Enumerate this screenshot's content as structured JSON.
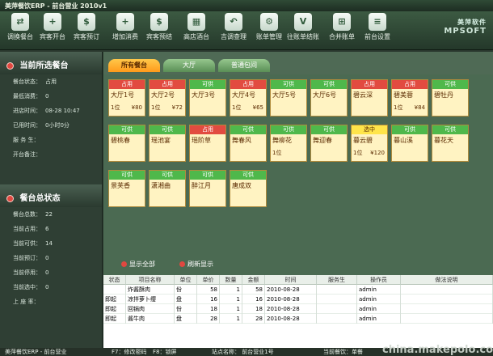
{
  "title": "美萍餐饮ERP - 前台营业 2010v1",
  "toolbar": [
    {
      "label": "调换餐台",
      "icon": "swap-icon"
    },
    {
      "label": "宾客开台",
      "icon": "open-table-icon"
    },
    {
      "label": "宾客预订",
      "icon": "reserve-icon"
    },
    {
      "label": "增加消费",
      "icon": "add-consume-icon"
    },
    {
      "label": "宾客预结",
      "icon": "prebill-icon"
    },
    {
      "label": "高店酒台",
      "icon": "hotel-table-icon"
    },
    {
      "label": "吉调查理",
      "icon": "undo-icon"
    },
    {
      "label": "账单管理",
      "icon": "gear-icon"
    },
    {
      "label": "往账单结账",
      "icon": "checkout-icon"
    },
    {
      "label": "合并账单",
      "icon": "merge-icon"
    },
    {
      "label": "前台设置",
      "icon": "settings-icon"
    }
  ],
  "brand": {
    "line1": "美萍软件",
    "line2": "MPSOFT"
  },
  "left": {
    "section1_title": "当前所选餐台",
    "items1": [
      {
        "k": "餐台状态：",
        "v": "占用"
      },
      {
        "k": "最低消费：",
        "v": "0"
      },
      {
        "k": "进店时间：",
        "v": "08-28 10:47"
      },
      {
        "k": "已用时间：",
        "v": "0小时0分"
      },
      {
        "k": "服 务 生：",
        "v": ""
      },
      {
        "k": "开台备注：",
        "v": ""
      }
    ],
    "section2_title": "餐台总状态",
    "items2": [
      {
        "k": "餐台总数：",
        "v": "22"
      },
      {
        "k": "当前占用：",
        "v": "6"
      },
      {
        "k": "当前可供：",
        "v": "14"
      },
      {
        "k": "当前预订：",
        "v": "0"
      },
      {
        "k": "当前停用：",
        "v": "0"
      },
      {
        "k": "当前选中：",
        "v": "0"
      },
      {
        "k": "上 座 率：",
        "v": ""
      }
    ]
  },
  "tabs": [
    "所有餐台",
    "大厅",
    "普通包间"
  ],
  "active_tab": 0,
  "tiles": [
    {
      "status": "占用",
      "color": "red",
      "name": "大厅1号",
      "people": "1位",
      "price": "¥80"
    },
    {
      "status": "占用",
      "color": "red",
      "name": "大厅2号",
      "people": "1位",
      "price": "¥72"
    },
    {
      "status": "可供",
      "color": "green",
      "name": "大厅3号",
      "people": "",
      "price": ""
    },
    {
      "status": "占用",
      "color": "red",
      "name": "大厅4号",
      "people": "1位",
      "price": "¥65"
    },
    {
      "status": "可供",
      "color": "green",
      "name": "大厅5号",
      "people": "",
      "price": ""
    },
    {
      "status": "可供",
      "color": "green",
      "name": "大厅6号",
      "people": "",
      "price": ""
    },
    {
      "status": "占用",
      "color": "red",
      "name": "碧云深",
      "people": "",
      "price": ""
    },
    {
      "status": "占用",
      "color": "red",
      "name": "碧美蓉",
      "people": "1位",
      "price": "¥84"
    },
    {
      "status": "可供",
      "color": "green",
      "name": "碧牡丹",
      "people": "",
      "price": ""
    },
    {
      "status": "可供",
      "color": "green",
      "name": "碧桃春",
      "people": "",
      "price": ""
    },
    {
      "status": "可供",
      "color": "green",
      "name": "瑶池宴",
      "people": "",
      "price": ""
    },
    {
      "status": "占用",
      "color": "red",
      "name": "瑶阶草",
      "people": "",
      "price": ""
    },
    {
      "status": "可供",
      "color": "green",
      "name": "舞春风",
      "people": "",
      "price": ""
    },
    {
      "status": "可供",
      "color": "green",
      "name": "舞柳花",
      "people": "1位",
      "price": ""
    },
    {
      "status": "可供",
      "color": "green",
      "name": "舞迎春",
      "people": "",
      "price": ""
    },
    {
      "status": "选中",
      "color": "yellow",
      "name": "暮云碧",
      "people": "1位",
      "price": "¥120"
    },
    {
      "status": "可供",
      "color": "green",
      "name": "暮山溪",
      "people": "",
      "price": ""
    },
    {
      "status": "可供",
      "color": "green",
      "name": "暮花天",
      "people": "",
      "price": ""
    },
    {
      "status": "可供",
      "color": "green",
      "name": "景芙香",
      "people": "",
      "price": ""
    },
    {
      "status": "可供",
      "color": "green",
      "name": "潇湘曲",
      "people": "",
      "price": ""
    },
    {
      "status": "可供",
      "color": "green",
      "name": "醉江月",
      "people": "",
      "price": ""
    },
    {
      "status": "可供",
      "color": "green",
      "name": "唐成双",
      "people": "",
      "price": ""
    }
  ],
  "midbar": {
    "show_all": "显示全部",
    "refresh": "刷新显示"
  },
  "table": {
    "headers": [
      "状态",
      "项目名称",
      "单位",
      "单价",
      "数量",
      "金额",
      "时间",
      "服务生",
      "操作员",
      "做法说明"
    ],
    "rows": [
      [
        "",
        "炸酱酥肉",
        "份",
        "58",
        "1",
        "58",
        "2010-08-28",
        "",
        "admin",
        ""
      ],
      [
        "即起",
        "凉拌萝卜缨",
        "盘",
        "16",
        "1",
        "16",
        "2010-08-28",
        "",
        "admin",
        ""
      ],
      [
        "即起",
        "回锅肉",
        "份",
        "18",
        "1",
        "18",
        "2010-08-28",
        "",
        "admin",
        ""
      ],
      [
        "即起",
        "酱牛肉",
        "盘",
        "28",
        "1",
        "28",
        "2010-08-28",
        "",
        "admin",
        ""
      ]
    ]
  },
  "statusbar": {
    "left": "美萍餐饮ERP - 前台营业",
    "f7": "F7：修改密码",
    "f8": "F8：锁屏",
    "site": "站点名称： 前台营业1号",
    "right": "当前餐饮：单餐"
  },
  "watermark": "china.makepolo.com"
}
